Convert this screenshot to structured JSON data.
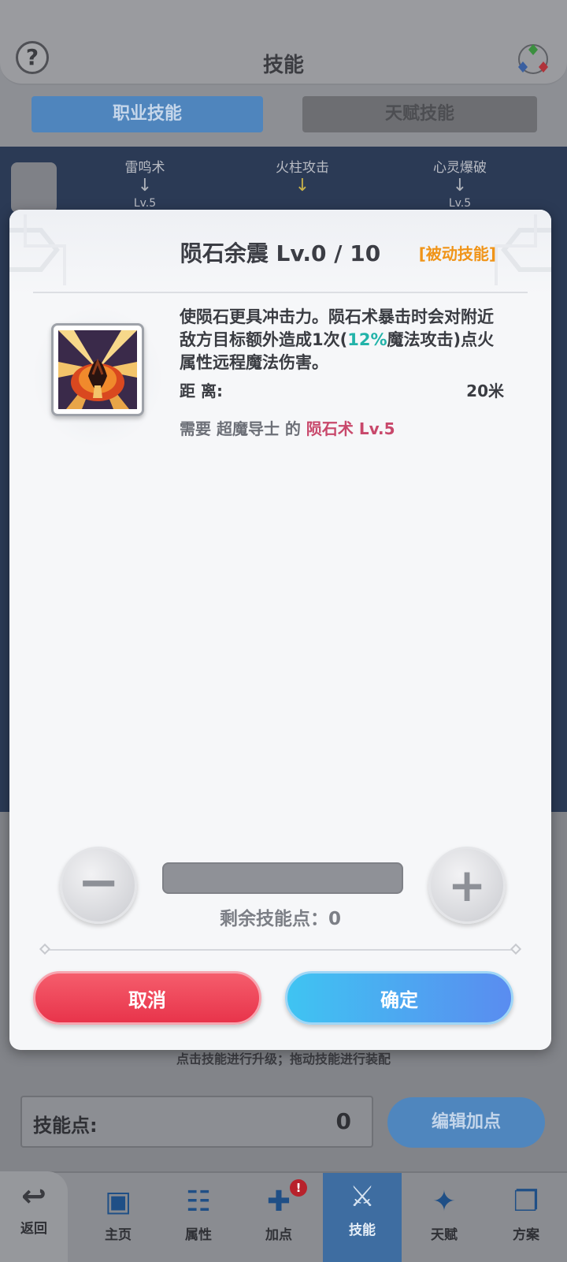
{
  "background": {
    "title": "技能",
    "tabs": [
      {
        "label": "职业技能",
        "active": true
      },
      {
        "label": "天赋技能",
        "active": false
      }
    ],
    "tree_skills": [
      {
        "name": "雷鸣术",
        "level": "Lv.5"
      },
      {
        "name": "火柱攻击",
        "level": ""
      },
      {
        "name": "心灵爆破",
        "level": "Lv.5"
      }
    ],
    "hint": "点击技能进行升级；拖动技能进行装配",
    "skill_points_label": "技能点:",
    "skill_points_value": "0",
    "edit_button": "编辑加点"
  },
  "nav": {
    "back": "返回",
    "items": [
      {
        "label": "主页",
        "icon": "id-card-icon"
      },
      {
        "label": "属性",
        "icon": "attributes-icon"
      },
      {
        "label": "加点",
        "icon": "add-points-icon",
        "badge": "!"
      },
      {
        "label": "技能",
        "icon": "skill-sword-icon",
        "active": true
      },
      {
        "label": "天赋",
        "icon": "talent-star-icon"
      },
      {
        "label": "方案",
        "icon": "cards-icon"
      }
    ]
  },
  "dialog": {
    "title": "陨石余震 Lv.0 / 10",
    "type": "[被动技能]",
    "desc_part1": "使陨石更具冲击力。陨石术暴击时会对附近敌方目标额外造成1次(",
    "desc_highlight": "12%",
    "desc_part2": "魔法攻击)点火属性远程魔法伤害。",
    "range_label": "距  离:",
    "range_value": "20米",
    "require_prefix": "需要 超魔导士 的 ",
    "require_skill": "陨石术 Lv.5",
    "remaining_label": "剩余技能点：0",
    "cancel": "取消",
    "confirm": "确定"
  },
  "colors": {
    "accent_blue": "#4f85bd",
    "passive_orange": "#f09418",
    "highlight_teal": "#22b3a9",
    "require_pink": "#c8486b",
    "cancel_red": "#e8344b",
    "confirm_blue": "#3fc4f2"
  }
}
